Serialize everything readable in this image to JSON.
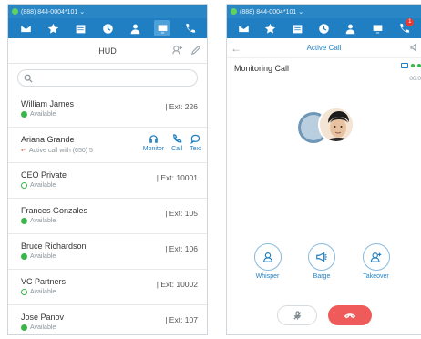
{
  "left": {
    "status_number": "(888) 844-0004*101 ⌄",
    "hud_title": "HUD",
    "search": {
      "value": "",
      "placeholder": ""
    },
    "contacts": [
      {
        "name": "William James",
        "ext": "| Ext: 226",
        "status": "Available"
      },
      {
        "name": "Ariana Grande",
        "ext": "",
        "status": "Active call with (650) 5"
      },
      {
        "name": "CEO Private",
        "ext": "| Ext: 10001",
        "status": "Available"
      },
      {
        "name": "Frances Gonzales",
        "ext": "| Ext: 105",
        "status": "Available"
      },
      {
        "name": "Bruce Richardson",
        "ext": "| Ext: 106",
        "status": "Available"
      },
      {
        "name": "VC Partners",
        "ext": "| Ext: 10002",
        "status": "Available"
      },
      {
        "name": "Jose Panov",
        "ext": "| Ext: 107",
        "status": "Available"
      }
    ],
    "row_actions": {
      "monitor": "Monitor",
      "call": "Call",
      "text": "Text"
    }
  },
  "right": {
    "status_number": "(888) 844-0004*101 ⌄",
    "header_title": "Active Call",
    "monitoring_label": "Monitoring Call",
    "timer": "00:0",
    "badge_count": "1",
    "actions": {
      "whisper": "Whisper",
      "barge": "Barge",
      "takeover": "Takeover"
    }
  },
  "colors": {
    "brand": "#1f7fc2",
    "available": "#3bb54a",
    "hangup": "#ef5a5a"
  }
}
